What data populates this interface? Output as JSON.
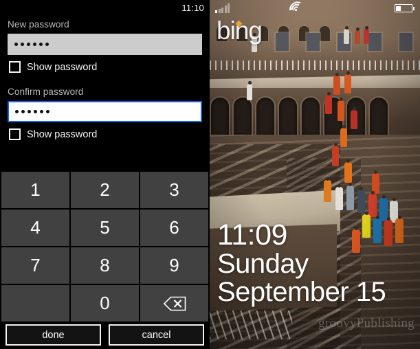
{
  "left_panel": {
    "status_time": "11:10",
    "new_password": {
      "label": "New password",
      "value_masked": "••••••",
      "dot_count": 6,
      "focused": false,
      "show_password_label": "Show password",
      "show_password_checked": false
    },
    "confirm_password": {
      "label": "Confirm password",
      "value_masked": "••••••",
      "dot_count": 6,
      "focused": true,
      "focus_color": "#1565ef",
      "show_password_label": "Show password",
      "show_password_checked": false
    },
    "keypad": {
      "keys": [
        "1",
        "2",
        "3",
        "4",
        "5",
        "6",
        "7",
        "8",
        "9",
        "",
        "0",
        "backspace"
      ],
      "backspace_icon": "backspace-icon",
      "key_color": "#414141",
      "key_text_color": "#ffffff"
    },
    "actions": {
      "done_label": "done",
      "cancel_label": "cancel"
    }
  },
  "right_panel": {
    "status_bar": {
      "signal_icon": "signal-bars-icon",
      "signal_bars_total": 5,
      "signal_bars_filled": 1,
      "wifi_icon": "wifi-icon",
      "battery_icon": "battery-icon",
      "battery_level_percent": 35
    },
    "bing_logo_text": "bing",
    "bing_accent_color": "#f2a93b",
    "lock_screen": {
      "time": "11:09",
      "day": "Sunday",
      "date": "September 15"
    },
    "watermark": "groovyPublishing",
    "wallpaper_description": "Chand Baori stepwell photograph with colorful sari-clad visitors on stone steps"
  }
}
